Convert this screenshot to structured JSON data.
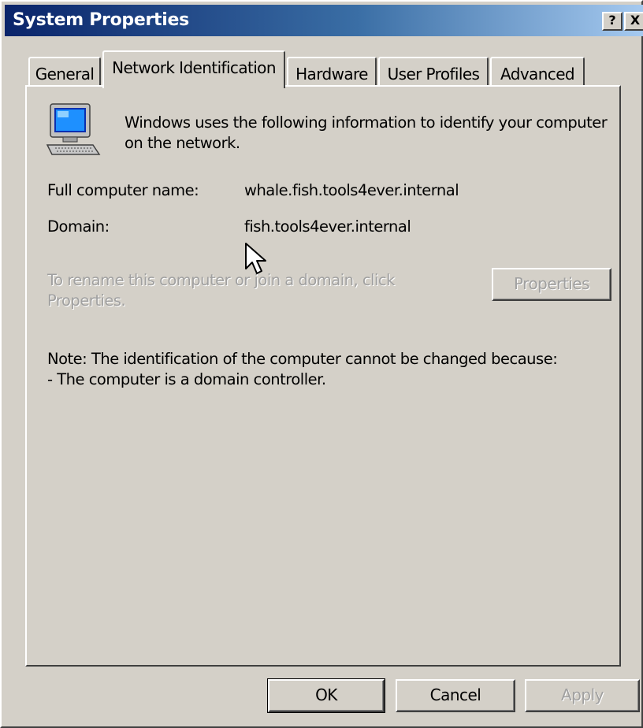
{
  "window": {
    "title": "System Properties",
    "help_glyph": "?",
    "close_glyph": "X"
  },
  "tabs": [
    {
      "label": "General",
      "active": false
    },
    {
      "label": "Network Identification",
      "active": true
    },
    {
      "label": "Hardware",
      "active": false
    },
    {
      "label": "User Profiles",
      "active": false
    },
    {
      "label": "Advanced",
      "active": false
    }
  ],
  "panel": {
    "intro_line1": "Windows uses the following information to identify your computer",
    "intro_line2": "on the network.",
    "full_name_label": "Full computer name:",
    "full_name_value": "whale.fish.tools4ever.internal",
    "domain_label": "Domain:",
    "domain_value": "fish.tools4ever.internal",
    "rename_line1": "To rename this computer or join a domain, click",
    "rename_line2": "Properties.",
    "properties_button": "Properties",
    "note_line1": "Note: The identification of the computer cannot be changed because:",
    "note_line2": "- The computer is a domain controller."
  },
  "footer": {
    "ok": "OK",
    "cancel": "Cancel",
    "apply": "Apply"
  },
  "icons": {
    "computer": "computer-icon",
    "cursor": "mouse-cursor-icon"
  },
  "colors": {
    "titlebar_start": "#0a246a",
    "titlebar_end": "#a6caf0",
    "face": "#d4d0c8",
    "disabled_text": "#a0a0a0"
  }
}
